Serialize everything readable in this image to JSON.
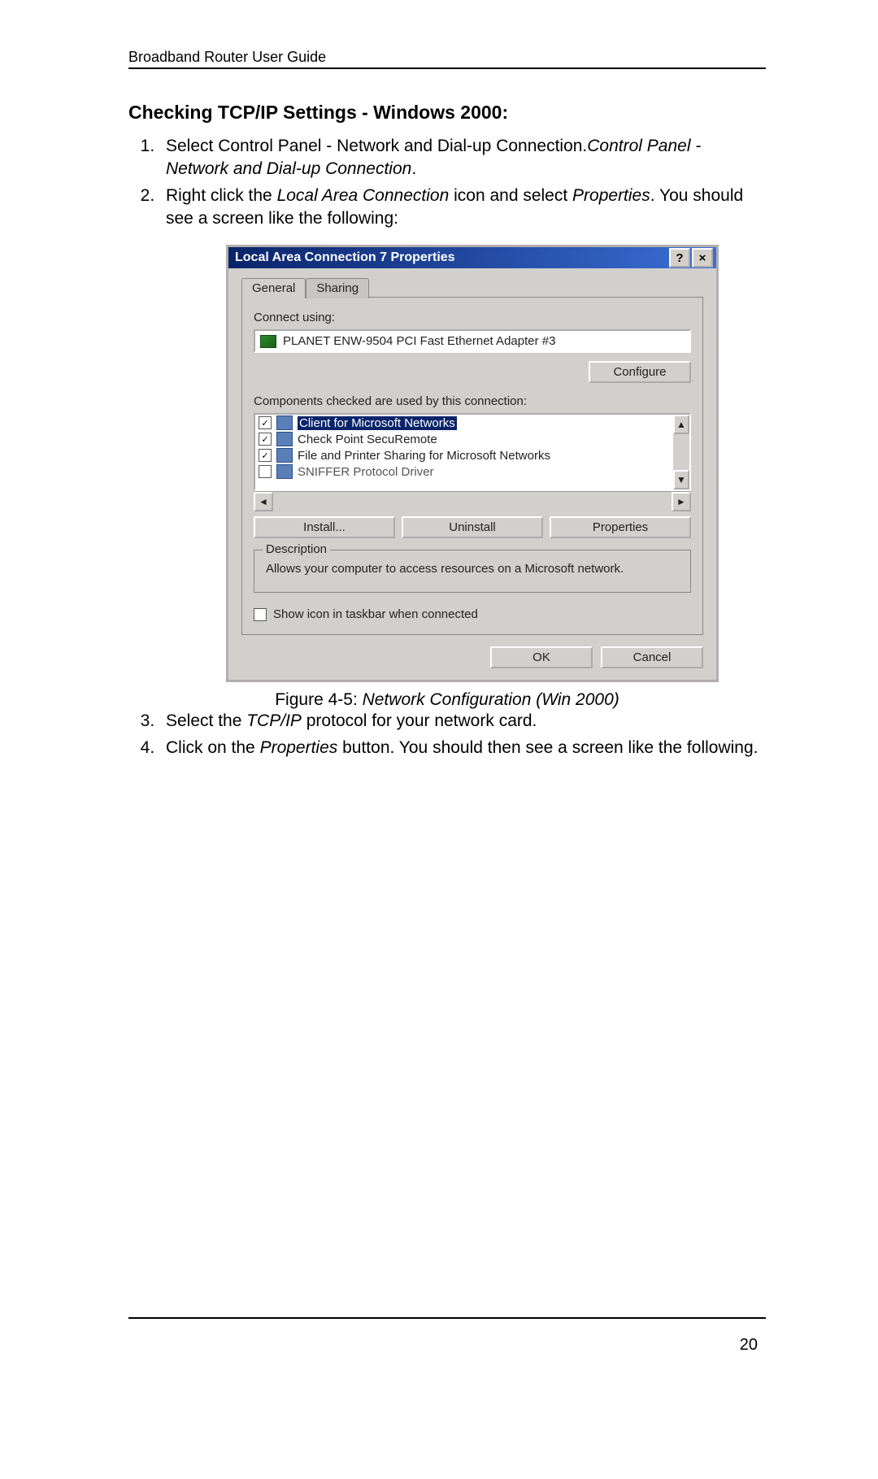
{
  "doc": {
    "header": "Broadband Router User Guide",
    "section_title": "Checking TCP/IP Settings - Windows 2000:",
    "step1": "Select Control Panel - Network and Dial-up Connection.",
    "step2a": "Right click the ",
    "step2b": "Local Area Connection",
    "step2c": " icon and select ",
    "step2d": "Properties",
    "step2e": ". You should see a screen like the following:",
    "caption_label": "Figure 4-5: ",
    "caption_title": "Network Configuration (Win 2000)",
    "step3a": "Select the ",
    "step3b": "TCP/IP",
    "step3c": " protocol for your network card.",
    "step4a": "Click on the ",
    "step4b": "Properties",
    "step4c": " button. You should then see a screen like the following.",
    "page_number": "20"
  },
  "dialog": {
    "title": "Local Area Connection 7 Properties",
    "help": "?",
    "close": "×",
    "tab_general": "General",
    "tab_sharing": "Sharing",
    "connect_using_label": "Connect using:",
    "adapter_name": "PLANET ENW-9504 PCI Fast Ethernet Adapter #3",
    "configure": "Configure",
    "components_label": "Components checked are used by this connection:",
    "items": {
      "i0": "Client for Microsoft Networks",
      "i1": "Check Point SecuRemote",
      "i2": "File and Printer Sharing for Microsoft Networks",
      "i3": "SNIFFER Protocol Driver"
    },
    "install": "Install...",
    "uninstall": "Uninstall",
    "properties": "Properties",
    "description_legend": "Description",
    "description_text": "Allows your computer to access resources on a Microsoft network.",
    "show_icon": "Show icon in taskbar when connected",
    "ok": "OK",
    "cancel": "Cancel",
    "check": "✓",
    "up": "▲",
    "down": "▼",
    "left": "◄",
    "right": "►"
  }
}
